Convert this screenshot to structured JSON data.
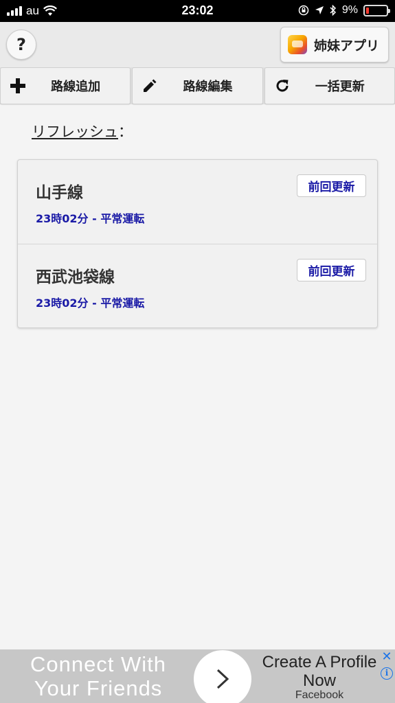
{
  "status_bar": {
    "carrier": "au",
    "time": "23:02",
    "battery_percent": "9%"
  },
  "top_bar": {
    "help_label": "?",
    "sister_apps_label": "姉妹アプリ"
  },
  "toolbar": {
    "add_route_label": "路線追加",
    "edit_route_label": "路線編集",
    "bulk_update_label": "一括更新"
  },
  "refresh": {
    "label": "リフレッシュ",
    "separator": "："
  },
  "routes": [
    {
      "name": "山手線",
      "status": "23時02分 - 平常運転",
      "button_label": "前回更新"
    },
    {
      "name": "西武池袋線",
      "status": "23時02分 - 平常運転",
      "button_label": "前回更新"
    }
  ],
  "ad": {
    "headline": "Connect With Your Friends",
    "cta": "Create A Profile Now",
    "source": "Facebook",
    "close_label": "✕",
    "info_label": "i"
  },
  "colors": {
    "status_text": "#1a1aa6",
    "battery_low": "#ff3b30",
    "ad_accent": "#1a73e8"
  }
}
